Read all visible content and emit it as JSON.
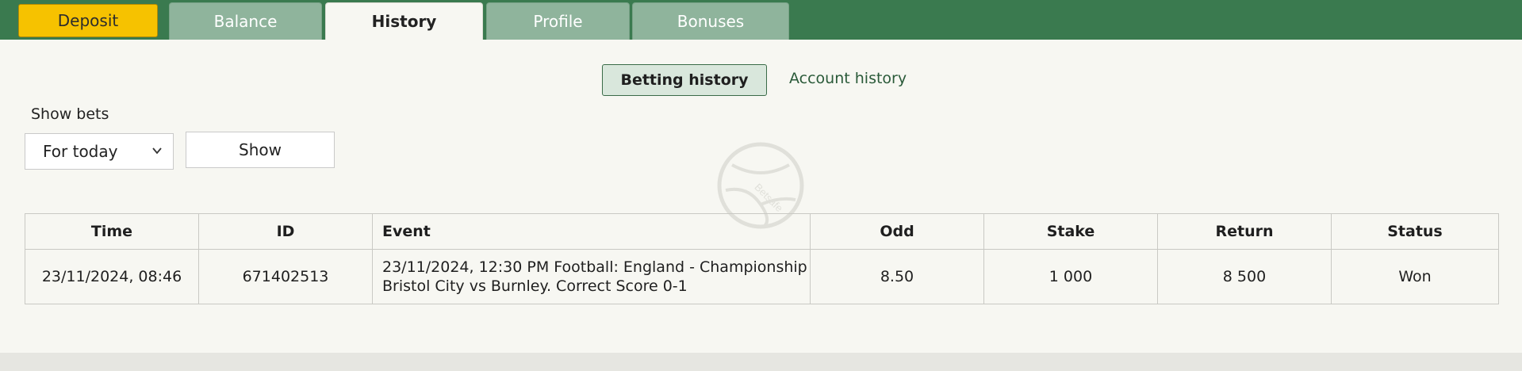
{
  "header": {
    "deposit_label": "Deposit",
    "tabs": [
      {
        "label": "Balance",
        "active": false
      },
      {
        "label": "History",
        "active": true
      },
      {
        "label": "Profile",
        "active": false
      },
      {
        "label": "Bonuses",
        "active": false
      }
    ]
  },
  "subnav": {
    "active_label": "Betting history",
    "link_label": "Account history"
  },
  "filter": {
    "label": "Show bets",
    "selected_option": "For today",
    "show_button_label": "Show"
  },
  "table": {
    "columns": [
      "Time",
      "ID",
      "Event",
      "Odd",
      "Stake",
      "Return",
      "Status"
    ],
    "rows": [
      {
        "time": "23/11/2024, 08:46",
        "id": "671402513",
        "event_line1": "23/11/2024, 12:30 PM Football: England - Championship",
        "event_line2": "Bristol City vs Burnley. Correct Score 0-1",
        "odd": "8.50",
        "stake": "1 000",
        "return": "8 500",
        "status": "Won"
      }
    ]
  },
  "watermark": {
    "text": "Betsafe",
    "icon": "football-watermark-icon"
  },
  "colors": {
    "topbar": "#3a7a4f",
    "tab_inactive": "#8fb49c",
    "deposit": "#f6c200",
    "status_link": "#1f6fc9",
    "odd_text": "#2a5a39",
    "page_bg": "#f7f7f2"
  }
}
